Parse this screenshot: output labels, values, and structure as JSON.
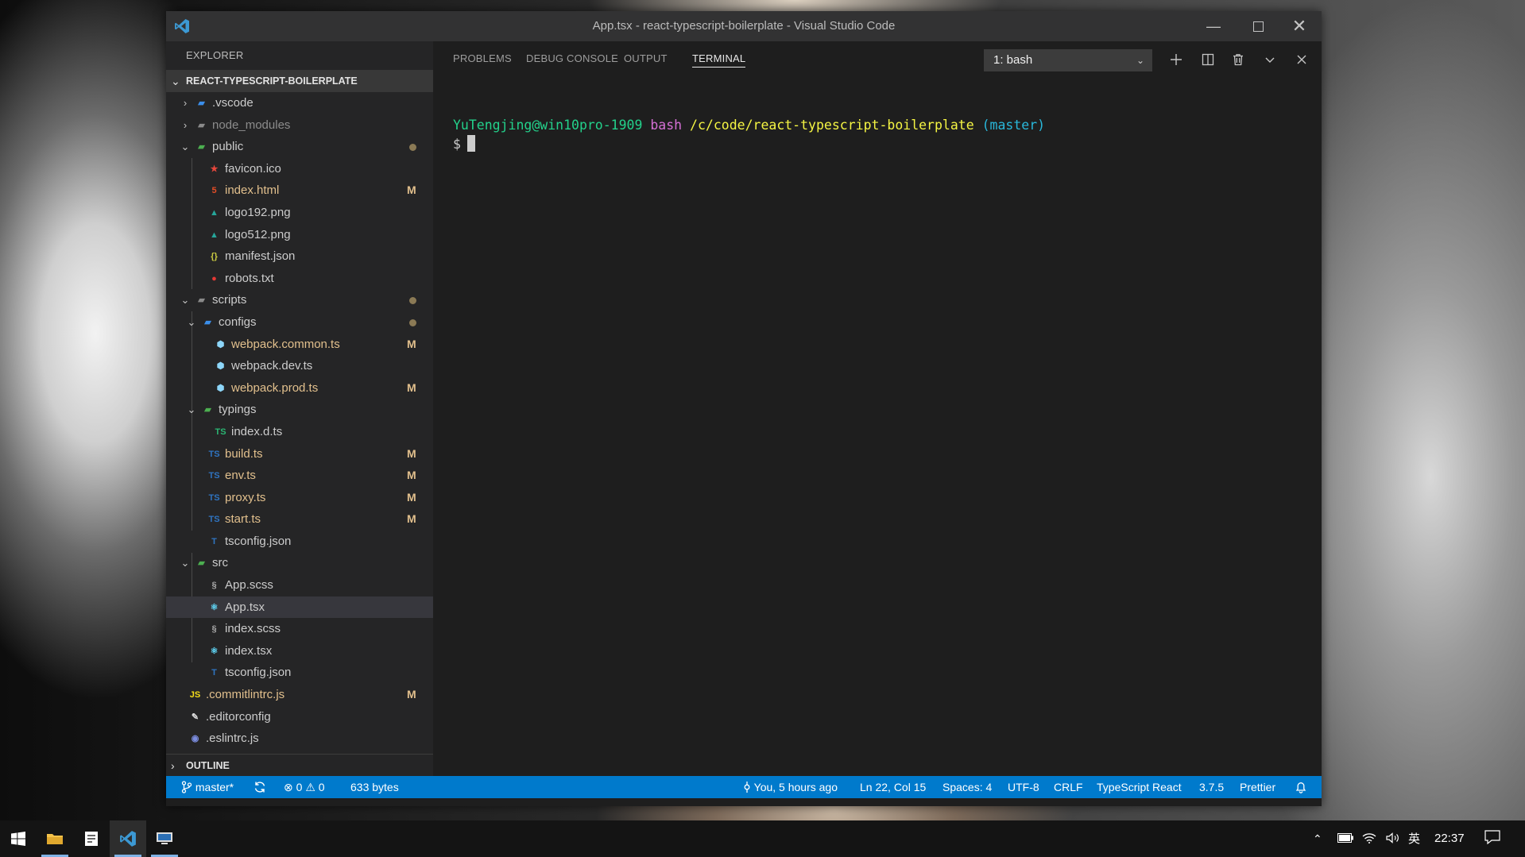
{
  "window": {
    "title": "App.tsx - react-typescript-boilerplate - Visual Studio Code"
  },
  "explorer": {
    "header": "EXPLORER",
    "project": "REACT-TYPESCRIPT-BOILERPLATE",
    "outline": "OUTLINE",
    "items": [
      {
        "name": ".vscode",
        "icon": "vscode-folder-icon",
        "status": ""
      },
      {
        "name": "node_modules",
        "icon": "node-folder-icon",
        "status": ""
      },
      {
        "name": "public",
        "icon": "public-folder-icon",
        "status": ""
      },
      {
        "name": "favicon.ico",
        "icon": "favicon-icon",
        "status": ""
      },
      {
        "name": "index.html",
        "icon": "html-icon",
        "status": "M"
      },
      {
        "name": "logo192.png",
        "icon": "image-icon",
        "status": ""
      },
      {
        "name": "logo512.png",
        "icon": "image-icon",
        "status": ""
      },
      {
        "name": "manifest.json",
        "icon": "json-icon",
        "status": ""
      },
      {
        "name": "robots.txt",
        "icon": "robots-icon",
        "status": ""
      },
      {
        "name": "scripts",
        "icon": "scripts-folder-icon",
        "status": ""
      },
      {
        "name": "configs",
        "icon": "config-folder-icon",
        "status": ""
      },
      {
        "name": "webpack.common.ts",
        "icon": "webpack-icon",
        "status": "M"
      },
      {
        "name": "webpack.dev.ts",
        "icon": "webpack-icon",
        "status": ""
      },
      {
        "name": "webpack.prod.ts",
        "icon": "webpack-icon",
        "status": "M"
      },
      {
        "name": "typings",
        "icon": "typings-folder-icon",
        "status": ""
      },
      {
        "name": "index.d.ts",
        "icon": "ts-def-icon",
        "status": ""
      },
      {
        "name": "build.ts",
        "icon": "ts-icon",
        "status": "M"
      },
      {
        "name": "env.ts",
        "icon": "ts-icon",
        "status": "M"
      },
      {
        "name": "proxy.ts",
        "icon": "ts-icon",
        "status": "M"
      },
      {
        "name": "start.ts",
        "icon": "ts-icon",
        "status": "M"
      },
      {
        "name": "tsconfig.json",
        "icon": "tsconfig-icon",
        "status": ""
      },
      {
        "name": "src",
        "icon": "src-folder-icon",
        "status": ""
      },
      {
        "name": "App.scss",
        "icon": "scss-icon",
        "status": ""
      },
      {
        "name": "App.tsx",
        "icon": "react-icon",
        "status": ""
      },
      {
        "name": "index.scss",
        "icon": "scss-icon",
        "status": ""
      },
      {
        "name": "index.tsx",
        "icon": "react-icon",
        "status": ""
      },
      {
        "name": "tsconfig.json",
        "icon": "tsconfig-icon",
        "status": ""
      },
      {
        "name": ".commitlintrc.js",
        "icon": "js-icon",
        "status": "M"
      },
      {
        "name": ".editorconfig",
        "icon": "editorconfig-icon",
        "status": ""
      },
      {
        "name": ".eslintrc.js",
        "icon": "eslint-icon",
        "status": ""
      }
    ]
  },
  "panel": {
    "tabs": [
      "PROBLEMS",
      "DEBUG CONSOLE",
      "OUTPUT",
      "TERMINAL"
    ],
    "active_tab": "TERMINAL",
    "terminal_select": "1: bash",
    "terminal": {
      "user": "YuTengjing@win10pro-1909",
      "shell": "bash",
      "path": "/c/code/react-typescript-boilerplate",
      "branch": "(master)",
      "prompt": "$"
    }
  },
  "statusbar": {
    "branch": "master*",
    "errors": "0",
    "warnings": "0",
    "size": "633 bytes",
    "blame": "You, 5 hours ago",
    "position": "Ln 22, Col 15",
    "spaces": "Spaces: 4",
    "encoding": "UTF-8",
    "eol": "CRLF",
    "language": "TypeScript React",
    "ts_version": "3.7.5",
    "formatter": "Prettier"
  },
  "taskbar": {
    "ime": "英",
    "time": "22:37"
  },
  "colors": {
    "statusbar": "#007acc",
    "sidebar": "#252526",
    "modified": "#e2c08d",
    "terminal_user": "#23d18b",
    "terminal_shell": "#d670d6",
    "terminal_path": "#f5f543",
    "terminal_branch": "#29b8db"
  }
}
